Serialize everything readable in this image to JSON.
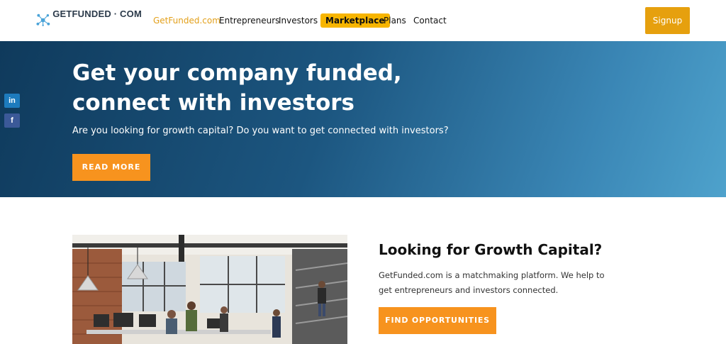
{
  "header": {
    "logo_text": "GETFUNDED · COM",
    "nav": [
      "GetFunded.com",
      "Entrepreneurs",
      "Investors",
      "Marketplace",
      "Plans",
      "Contact"
    ],
    "signup_label": "Signup"
  },
  "hero": {
    "title_line1": "Get your company funded,",
    "title_line2": "connect with investors",
    "subtitle": "Are you looking for growth capital? Do you want to get connected with investors?",
    "read_more_label": "READ MORE"
  },
  "social": {
    "linkedin_label": "in",
    "facebook_label": "f"
  },
  "section": {
    "title": "Looking for Growth Capital?",
    "text": "GetFunded.com is a matchmaking platform. We help to get entrepreneurs and investors connected.",
    "button_label": "FIND OPPORTUNITIES"
  },
  "colors": {
    "accent_orange": "#f7931e",
    "signup_gold": "#e6a00e",
    "marketplace_yellow": "#f7b500",
    "hero_dark": "#0f3a5c",
    "hero_light": "#4ea2cc"
  },
  "icons": [
    "network-logo-icon",
    "linkedin-icon",
    "facebook-icon"
  ]
}
